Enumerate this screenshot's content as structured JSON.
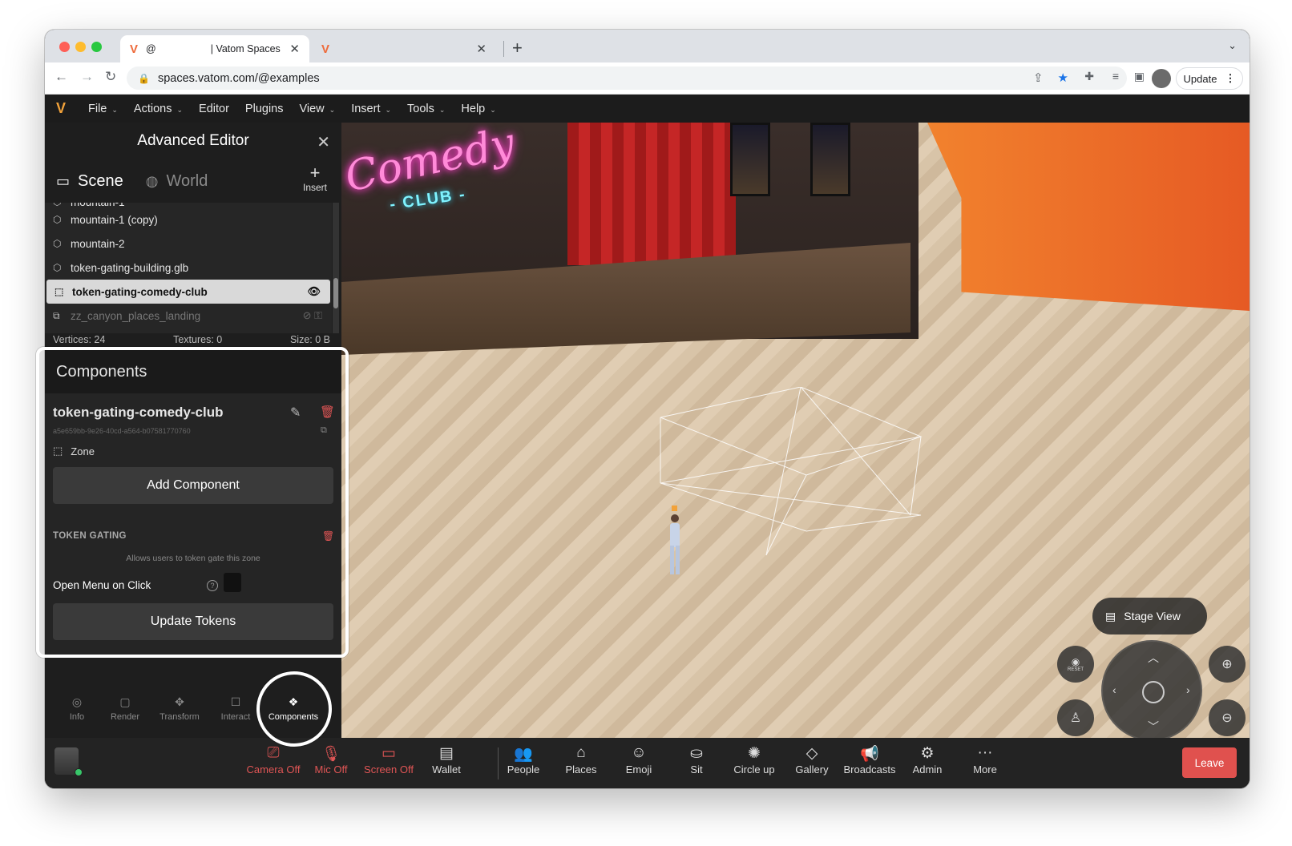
{
  "browser": {
    "tabs": [
      {
        "title_prefix": "@",
        "title_suffix": "| Vatom Spaces",
        "active": true
      },
      {
        "title": "",
        "active": false
      }
    ],
    "url": "spaces.vatom.com/@examples",
    "update_label": "Update"
  },
  "menu": {
    "items": [
      "File",
      "Actions",
      "Editor",
      "Plugins",
      "View",
      "Insert",
      "Tools",
      "Help"
    ],
    "with_caret": [
      true,
      true,
      false,
      false,
      true,
      true,
      true,
      true
    ]
  },
  "editor": {
    "title": "Advanced Editor",
    "tabs": {
      "scene": "Scene",
      "world": "World"
    },
    "insert_label": "Insert",
    "tree": [
      {
        "label": "mountain-1",
        "state": "partial"
      },
      {
        "label": "mountain-1 (copy)",
        "state": "normal"
      },
      {
        "label": "mountain-2",
        "state": "normal"
      },
      {
        "label": "token-gating-building.glb",
        "state": "normal"
      },
      {
        "label": "token-gating-comedy-club",
        "state": "selected"
      },
      {
        "label": "zz_canyon_places_landing",
        "state": "hidden"
      }
    ],
    "stats": {
      "vertices": "Vertices: 24",
      "textures": "Textures: 0",
      "size": "Size: 0 B"
    }
  },
  "components": {
    "header": "Components",
    "object_name": "token-gating-comedy-club",
    "object_id": "a5e659bb-9e26-40cd-a564-b07581770760",
    "object_type": "Zone",
    "add_button": "Add Component",
    "section_label": "TOKEN GATING",
    "section_desc": "Allows users to token gate this zone",
    "open_menu_label": "Open Menu on Click",
    "update_button": "Update Tokens"
  },
  "editor_bottom_tabs": [
    "Info",
    "Render",
    "Transform",
    "Interact",
    "Components"
  ],
  "viewport": {
    "neon_main": "Comedy",
    "neon_sub": "- CLUB -",
    "stage_view_label": "Stage View",
    "reset_label": "RESET"
  },
  "bottombar": {
    "media": [
      {
        "label": "Camera Off",
        "icon": "camera-off-icon",
        "red": true
      },
      {
        "label": "Mic Off",
        "icon": "mic-off-icon",
        "red": true
      },
      {
        "label": "Screen Off",
        "icon": "screen-off-icon",
        "red": true
      },
      {
        "label": "Wallet",
        "icon": "wallet-icon",
        "red": false
      }
    ],
    "actions": [
      {
        "label": "People",
        "icon": "people-icon"
      },
      {
        "label": "Places",
        "icon": "places-icon"
      },
      {
        "label": "Emoji",
        "icon": "emoji-icon"
      },
      {
        "label": "Sit",
        "icon": "sit-icon"
      },
      {
        "label": "Circle up",
        "icon": "circle-up-icon"
      },
      {
        "label": "Gallery",
        "icon": "gallery-icon"
      },
      {
        "label": "Broadcasts",
        "icon": "broadcasts-icon"
      },
      {
        "label": "Admin",
        "icon": "admin-icon"
      },
      {
        "label": "More",
        "icon": "more-icon"
      }
    ],
    "leave_label": "Leave"
  },
  "colors": {
    "accent_red": "#e0514e",
    "brand_orange": "#f2a23a",
    "selection": "#d9d9d9"
  }
}
